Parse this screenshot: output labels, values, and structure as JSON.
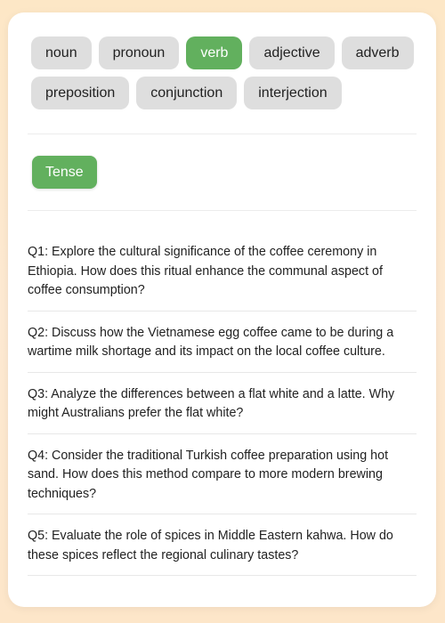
{
  "parts_of_speech": [
    {
      "label": "noun",
      "active": false
    },
    {
      "label": "pronoun",
      "active": false
    },
    {
      "label": "verb",
      "active": true
    },
    {
      "label": "adjective",
      "active": false
    },
    {
      "label": "adverb",
      "active": false
    },
    {
      "label": "preposition",
      "active": false
    },
    {
      "label": "conjunction",
      "active": false
    },
    {
      "label": "interjection",
      "active": false
    }
  ],
  "subcategory": {
    "label": "Tense"
  },
  "questions": [
    "Q1: Explore the cultural significance of the coffee ceremony in Ethiopia. How does this ritual enhance the communal aspect of coffee consumption?",
    "Q2: Discuss how the Vietnamese egg coffee came to be during a wartime milk shortage and its impact on the local coffee culture.",
    "Q3: Analyze the differences between a flat white and a latte. Why might Australians prefer the flat white?",
    "Q4: Consider the traditional Turkish coffee preparation using hot sand. How does this method compare to more modern brewing techniques?",
    "Q5: Evaluate the role of spices in Middle Eastern kahwa. How do these spices reflect the regional culinary tastes?"
  ],
  "colors": {
    "accent": "#62b05e",
    "button_bg": "#dedede",
    "page_bg": "#fde7c6"
  }
}
